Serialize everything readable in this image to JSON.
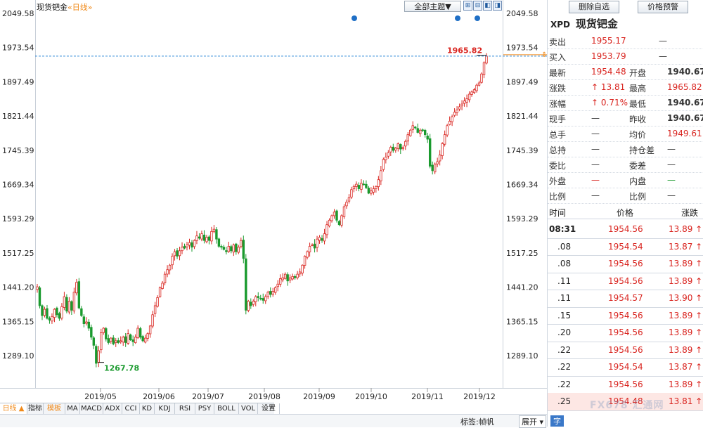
{
  "chart_header": {
    "title": "现货钯金",
    "period": "«日线»",
    "theme_button": "全部主题▼",
    "nav_buttons": [
      "⊞",
      "⊟",
      "◧",
      "◨"
    ]
  },
  "chart_data": {
    "type": "candlestick",
    "instrument": "现货钯金",
    "period": "日线",
    "y_ticks": [
      "2049.58",
      "1973.54",
      "1897.49",
      "1821.44",
      "1745.39",
      "1669.34",
      "1593.29",
      "1517.25",
      "1441.20",
      "1365.15",
      "1289.10"
    ],
    "ylim": [
      1245,
      2052
    ],
    "x_ticks": [
      "2019/05",
      "2019/06",
      "2019/07",
      "2019/08",
      "2019/09",
      "2019/10",
      "2019/11",
      "2019/12"
    ],
    "last_price_line": 1954.48,
    "high_label": "1965.82",
    "low_label": "1267.78",
    "close_series": [
      1442,
      1400,
      1378,
      1392,
      1372,
      1368,
      1376,
      1392,
      1380,
      1372,
      1398,
      1420,
      1388,
      1410,
      1390,
      1430,
      1452,
      1395,
      1378,
      1360,
      1364,
      1350,
      1330,
      1312,
      1272,
      1300,
      1340,
      1350,
      1326,
      1318,
      1328,
      1315,
      1322,
      1318,
      1322,
      1330,
      1318,
      1338,
      1324,
      1320,
      1330,
      1350,
      1330,
      1322,
      1328,
      1338,
      1355,
      1380,
      1400,
      1418,
      1440,
      1450,
      1470,
      1480,
      1490,
      1510,
      1520,
      1510,
      1522,
      1530,
      1528,
      1535,
      1540,
      1530,
      1545,
      1555,
      1550,
      1560,
      1545,
      1552,
      1545,
      1565,
      1570,
      1548,
      1532,
      1530,
      1525,
      1520,
      1532,
      1522,
      1535,
      1520,
      1530,
      1545,
      1505,
      1390,
      1410,
      1400,
      1410,
      1420,
      1418,
      1415,
      1412,
      1420,
      1430,
      1425,
      1432,
      1440,
      1448,
      1460,
      1462,
      1470,
      1455,
      1462,
      1465,
      1462,
      1470,
      1475,
      1490,
      1510,
      1520,
      1532,
      1535,
      1528,
      1548,
      1552,
      1545,
      1560,
      1580,
      1590,
      1600,
      1608,
      1590,
      1580,
      1600,
      1620,
      1630,
      1640,
      1658,
      1665,
      1670,
      1660,
      1672,
      1670,
      1662,
      1650,
      1655,
      1660,
      1665,
      1680,
      1700,
      1725,
      1730,
      1740,
      1752,
      1745,
      1750,
      1760,
      1748,
      1752,
      1765,
      1780,
      1790,
      1800,
      1795,
      1785,
      1790,
      1790,
      1780,
      1770,
      1710,
      1700,
      1715,
      1720,
      1735,
      1760,
      1780,
      1800,
      1810,
      1820,
      1830,
      1835,
      1842,
      1848,
      1855,
      1860,
      1870,
      1875,
      1880,
      1890,
      1895,
      1915,
      1940,
      1954.48
    ]
  },
  "quote": {
    "code": "XPD",
    "name": "现货钯金",
    "delete_button": "删除自选",
    "alert_button": "价格预警",
    "rows": [
      {
        "l1": "卖出",
        "v1": "1955.17",
        "l2": "",
        "v2": "—",
        "c1": "red",
        "c2": "dim"
      },
      {
        "l1": "买入",
        "v1": "1953.79",
        "l2": "",
        "v2": "—",
        "c1": "red",
        "c2": "dim"
      },
      {
        "l1": "最新",
        "v1": "1954.48",
        "l2": "开盘",
        "v2": "1940.67",
        "c1": "red",
        "c2": "dim"
      },
      {
        "l1": "涨跌",
        "v1": "↑ 13.81",
        "l2": "最高",
        "v2": "1965.82",
        "c1": "red",
        "c2": "red"
      },
      {
        "l1": "涨幅",
        "v1": "↑ 0.71%",
        "l2": "最低",
        "v2": "1940.67",
        "c1": "red",
        "c2": "dim"
      },
      {
        "l1": "现手",
        "v1": "—",
        "l2": "昨收",
        "v2": "1940.67",
        "c1": "dim",
        "c2": "dim"
      },
      {
        "l1": "总手",
        "v1": "—",
        "l2": "均价",
        "v2": "1949.61",
        "c1": "dim",
        "c2": "red"
      },
      {
        "l1": "总持",
        "v1": "—",
        "l2": "持仓差",
        "v2": "—",
        "c1": "dim",
        "c2": "dim"
      },
      {
        "l1": "委比",
        "v1": "—",
        "l2": "委差",
        "v2": "—",
        "c1": "dim",
        "c2": "dim"
      },
      {
        "l1": "外盘",
        "v1": "—",
        "l2": "内盘",
        "v2": "—",
        "c1": "red",
        "c2": "green"
      },
      {
        "l1": "比例",
        "v1": "—",
        "l2": "比例",
        "v2": "—",
        "c1": "dim",
        "c2": "dim"
      }
    ]
  },
  "ticks": {
    "headers": [
      "时间",
      "价格",
      "涨跌"
    ],
    "rows": [
      {
        "time": "08:31",
        "price": "1954.56",
        "change": "13.89 ↑"
      },
      {
        "time": ".08",
        "price": "1954.54",
        "change": "13.87 ↑"
      },
      {
        "time": ".08",
        "price": "1954.56",
        "change": "13.89 ↑"
      },
      {
        "time": ".11",
        "price": "1954.56",
        "change": "13.89 ↑"
      },
      {
        "time": ".11",
        "price": "1954.57",
        "change": "13.90 ↑"
      },
      {
        "time": ".15",
        "price": "1954.56",
        "change": "13.89 ↑"
      },
      {
        "time": ".20",
        "price": "1954.56",
        "change": "13.89 ↑"
      },
      {
        "time": ".22",
        "price": "1954.56",
        "change": "13.89 ↑"
      },
      {
        "time": ".22",
        "price": "1954.54",
        "change": "13.87 ↑"
      },
      {
        "time": ".22",
        "price": "1954.56",
        "change": "13.89 ↑"
      },
      {
        "time": ".25",
        "price": "1954.48",
        "change": "13.81 ↑"
      }
    ]
  },
  "bottom_tabs": [
    "日线 ▲",
    "指标",
    "模板",
    "MA",
    "MACD",
    "ADX",
    "CCI",
    "KD",
    "KDJ",
    "RSI",
    "PSY",
    "BOLL",
    "VOL",
    "设置"
  ],
  "status_bar": {
    "label": "标签:帧帆",
    "expand": "展开 ▾",
    "last": "字"
  },
  "watermark": "FX678 汇通网",
  "colors": {
    "up": "#d9241f",
    "down": "#1a9a2e",
    "dash": "#2f86d6",
    "marker": "#1f6fc6",
    "orange": "#f08a1a"
  }
}
